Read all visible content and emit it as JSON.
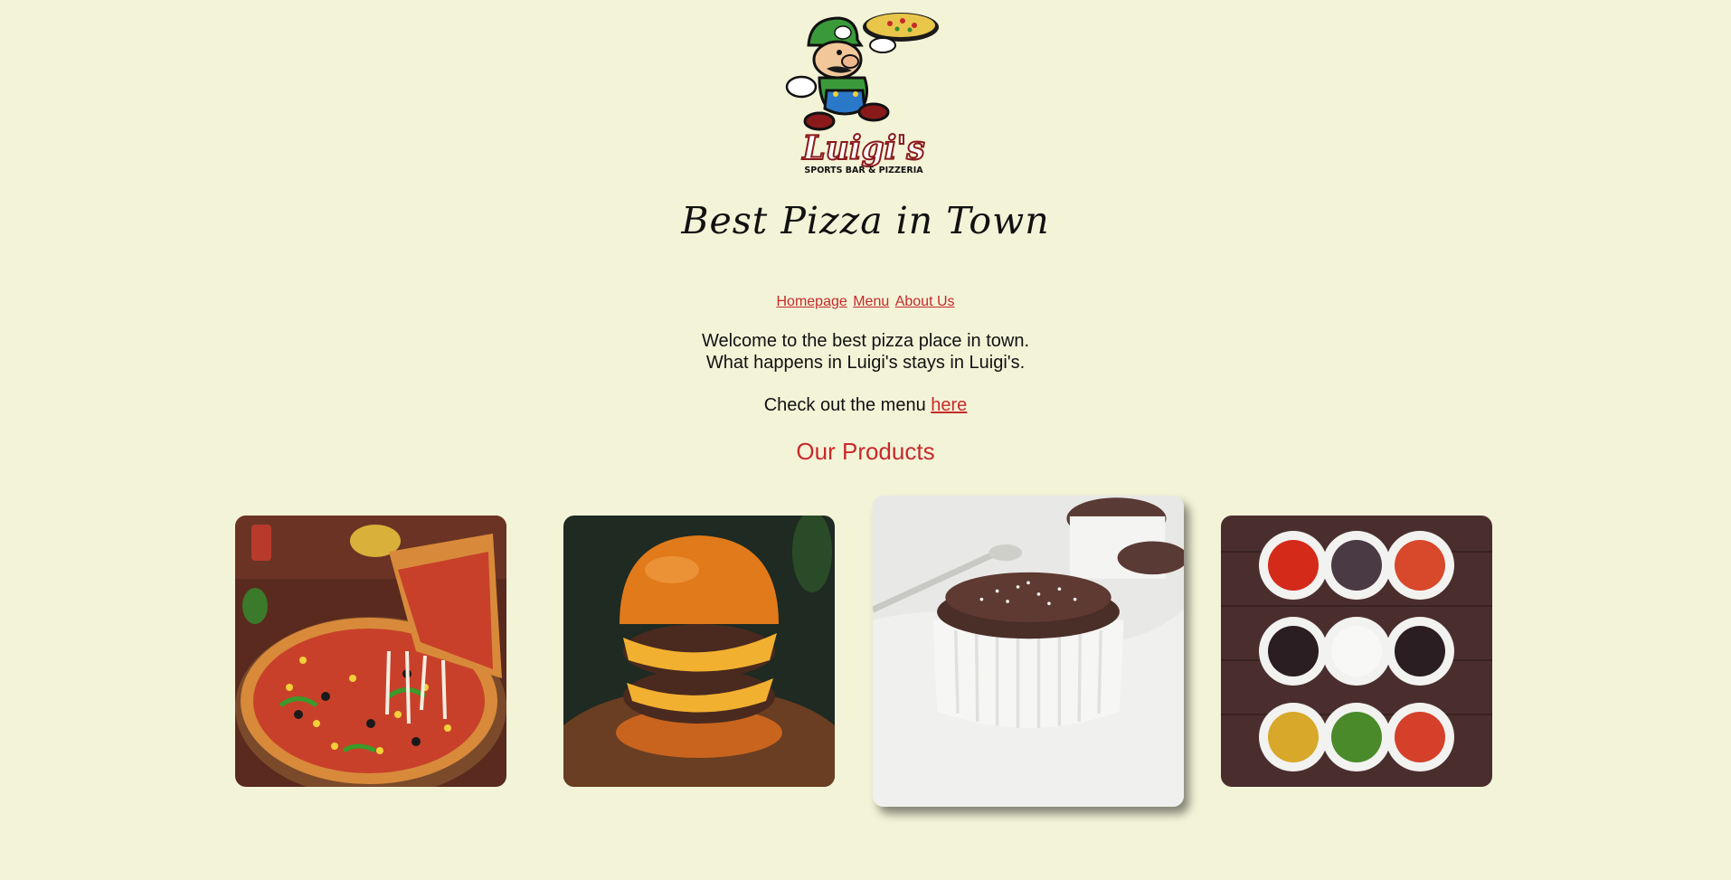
{
  "logo": {
    "brand": "Luigi's",
    "subtext": "SPORTS BAR & PIZZERIA"
  },
  "tagline": "Best Pizza in Town",
  "nav": {
    "items": [
      {
        "label": "Homepage"
      },
      {
        "label": "Menu"
      },
      {
        "label": "About Us"
      }
    ]
  },
  "welcome": {
    "line1": "Welcome to the best pizza place in town.",
    "line2": "What happens in Luigi's stays in Luigi's."
  },
  "menu_cta": {
    "text": "Check out the menu",
    "link": "here"
  },
  "products": {
    "title": "Our Products",
    "items": [
      {
        "name": "pizza",
        "highlighted": false
      },
      {
        "name": "burger",
        "highlighted": false
      },
      {
        "name": "chocolate-souffle",
        "highlighted": true
      },
      {
        "name": "sauces",
        "highlighted": false
      }
    ]
  },
  "colors": {
    "background": "#f3f3d8",
    "accent": "#c62a2a",
    "text": "#111111"
  }
}
